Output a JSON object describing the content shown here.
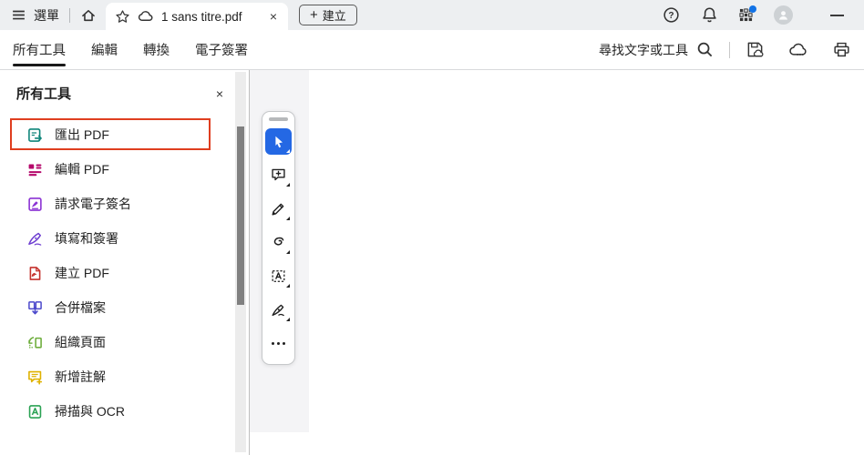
{
  "colors": {
    "titlebar_bg": "#edeff1",
    "accent_blue": "#1273e6",
    "select_tool_blue": "#2468e4",
    "highlight_red": "#df3e1f",
    "tab_underline": "#1a1a1a"
  },
  "titlebar": {
    "menu_label": "選單",
    "tab_title": "1 sans titre.pdf",
    "tab_close": "×",
    "create_plus": "+",
    "create_label": "建立",
    "right_icons": [
      "help-icon",
      "notifications-icon",
      "apps-grid-icon",
      "account-avatar",
      "minimize-button"
    ]
  },
  "menubar": {
    "tabs": [
      {
        "label": "所有工具",
        "active": true
      },
      {
        "label": "編輯",
        "active": false
      },
      {
        "label": "轉換",
        "active": false
      },
      {
        "label": "電子簽署",
        "active": false
      }
    ],
    "search_label": "尋找文字或工具",
    "right_icons": [
      "search-icon",
      "save-icon",
      "cloud-upload-icon",
      "print-icon"
    ]
  },
  "sidebar": {
    "title": "所有工具",
    "close_glyph": "×",
    "items": [
      {
        "label": "匯出 PDF",
        "icon": "export-pdf-icon",
        "color": "#0e857a",
        "highlighted": true
      },
      {
        "label": "編輯 PDF",
        "icon": "edit-pdf-icon",
        "color": "#b5086b",
        "highlighted": false
      },
      {
        "label": "請求電子簽名",
        "icon": "request-signature-icon",
        "color": "#8b32d4",
        "highlighted": false
      },
      {
        "label": "填寫和簽署",
        "icon": "fill-sign-icon",
        "color": "#6e3fd1",
        "highlighted": false
      },
      {
        "label": "建立 PDF",
        "icon": "create-pdf-icon",
        "color": "#c5332e",
        "highlighted": false
      },
      {
        "label": "合併檔案",
        "icon": "combine-files-icon",
        "color": "#4b48cb",
        "highlighted": false
      },
      {
        "label": "組織頁面",
        "icon": "organize-pages-icon",
        "color": "#6fae3e",
        "highlighted": false
      },
      {
        "label": "新增註解",
        "icon": "add-comments-icon",
        "color": "#dfb200",
        "highlighted": false
      },
      {
        "label": "掃描與 OCR",
        "icon": "scan-ocr-icon",
        "color": "#2ba254",
        "highlighted": false
      }
    ]
  },
  "quick_tools": {
    "tools": [
      "select-tool",
      "add-comment-tool",
      "highlight-tool",
      "draw-tool",
      "add-text-tool",
      "fill-and-sign-tool",
      "more-tools"
    ],
    "selected": "select-tool"
  }
}
